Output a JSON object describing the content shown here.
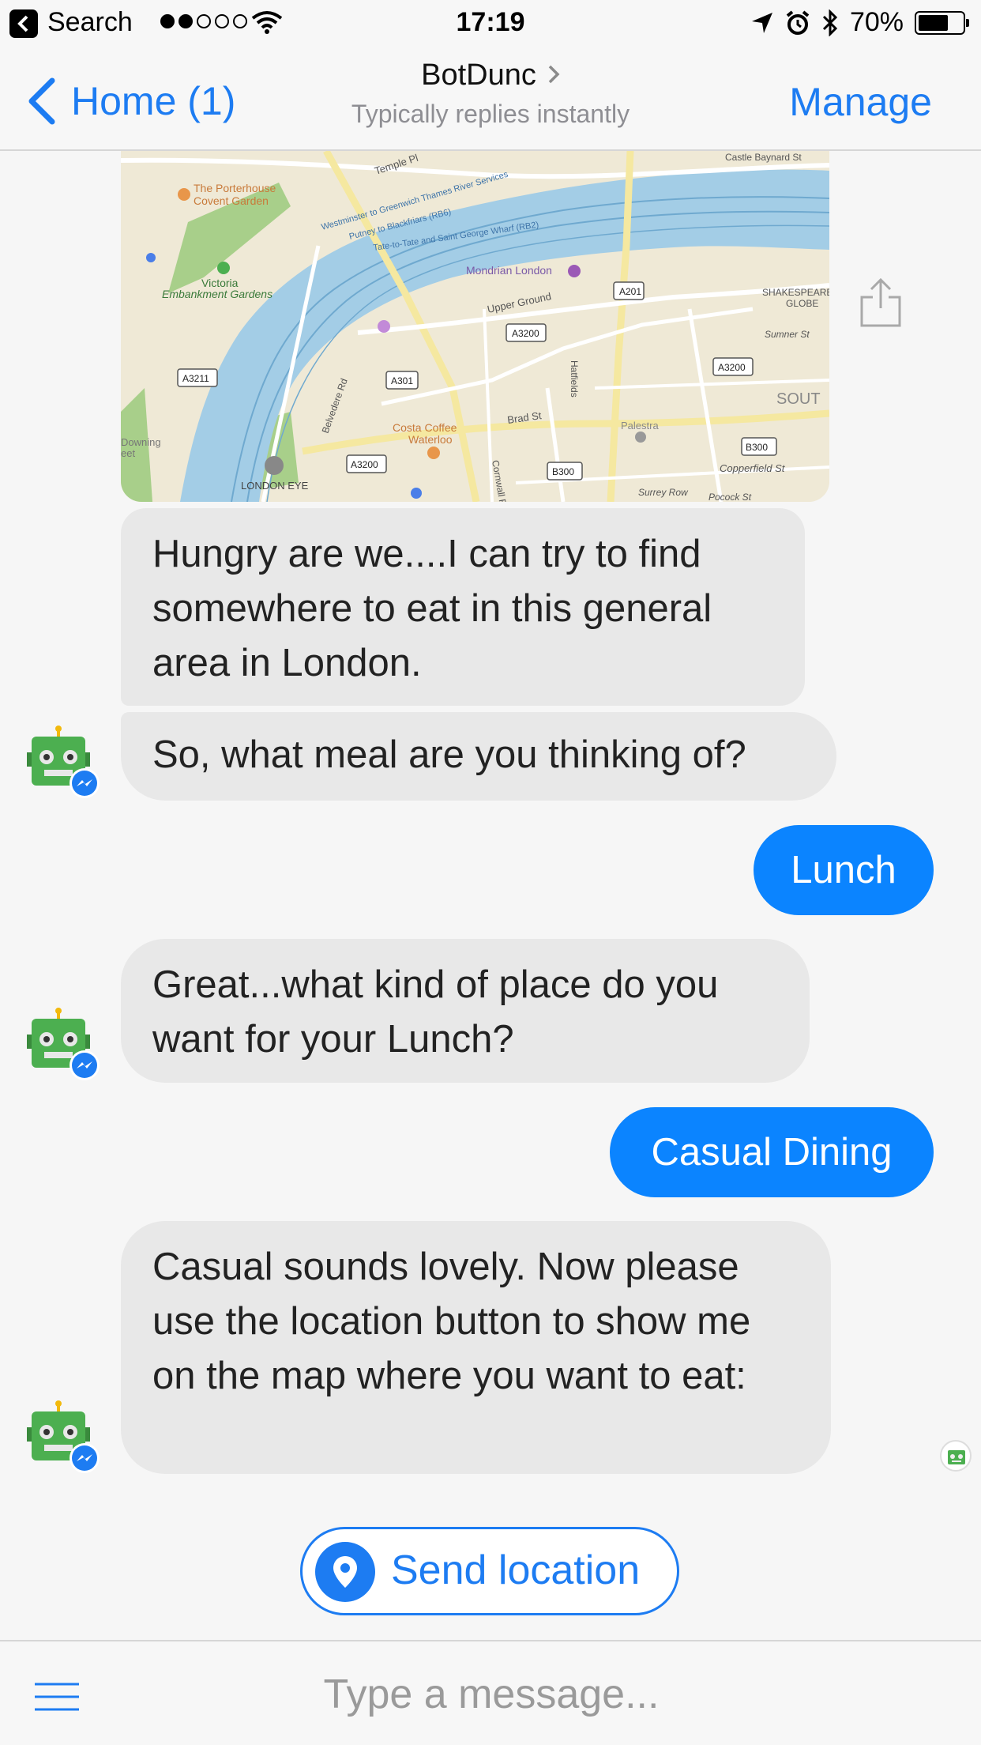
{
  "status_bar": {
    "back_app": "Search",
    "signal_dots": [
      true,
      true,
      false,
      false,
      false
    ],
    "time": "17:19",
    "battery_percent": "70%",
    "battery_level": 0.7
  },
  "nav": {
    "back_label": "Home (1)",
    "title": "BotDunc",
    "subtitle": "Typically replies instantly",
    "manage_label": "Manage"
  },
  "map": {
    "labels": {
      "temple_pl": "Temple Pl",
      "castle": "Castle Baynard St",
      "porterhouse1": "The Porterhouse",
      "porterhouse2": "Covent Garden",
      "river1": "Westminster to Greenwich Thames River Services",
      "river2": "Putney to Blackfriars (RB6)",
      "river3": "Tate-to-Tate and Saint George Wharf (RB2)",
      "mondrian": "Mondrian London",
      "victoria1": "Victoria",
      "victoria2": "Embankment Gardens",
      "upper_ground": "Upper Ground",
      "a201": "A201",
      "a3200_top": "A3200",
      "shakespeare1": "SHAKESPEARE",
      "shakespeare2": "GLOBE",
      "sumner": "Sumner St",
      "a3211": "A3211",
      "a301": "A301",
      "hatfields": "Hatfields",
      "a3200_right": "A3200",
      "south": "SOUT",
      "belvedere": "Belvedere Rd",
      "brad": "Brad St",
      "palestra": "Palestra",
      "costa1": "Costa Coffee",
      "costa2": "Waterloo",
      "downing1": "Downing",
      "downing2": "eet",
      "b300_right": "B300",
      "copperfield": "Copperfield St",
      "a3200_bottom": "A3200",
      "cornwall": "Cornwall Rd",
      "b300_bottom": "B300",
      "london_eye": "LONDON EYE",
      "surrey_row": "Surrey Row",
      "pocock": "Pocock St"
    }
  },
  "messages": {
    "m1": "Hungry are we....I can try to find somewhere to eat in this general area in London.",
    "m2": "So, what meal are you thinking of?",
    "m3": "Lunch",
    "m4": "Great...what kind of place do you want for your Lunch?",
    "m5": "Casual Dining",
    "m6": "Casual sounds lovely. Now please use the location button to show me on the map where you want to eat:"
  },
  "quick_reply": {
    "label": "Send location"
  },
  "composer": {
    "placeholder": "Type a message..."
  },
  "colors": {
    "accent": "#1d7cf2",
    "outgoing_bubble": "#0b84ff",
    "incoming_bubble": "#e8e8e8",
    "water": "#a3cde6",
    "park": "#a8cf8a"
  }
}
